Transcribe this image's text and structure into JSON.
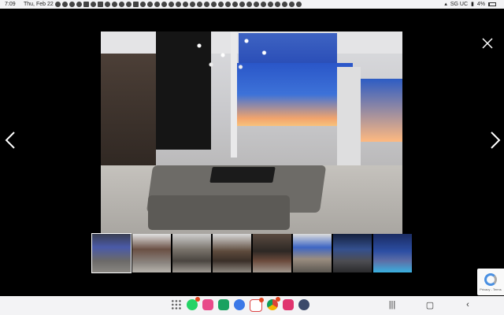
{
  "status_bar": {
    "time": "7:09",
    "date": "Thu, Feb 22",
    "carrier": "SG UC",
    "battery": "4%"
  },
  "viewer": {
    "main_image_alt": "",
    "prev_icon": "chevron-left-icon",
    "next_icon": "chevron-right-icon",
    "close_icon": "close-icon",
    "thumbnails_count": 8,
    "active_thumbnail": 1
  },
  "recaptcha": {
    "text": "Privacy - Terms"
  },
  "nav_bar": {
    "apps": [
      "apps-grid-icon",
      "whatsapp-icon",
      "messenger-icon",
      "chat-icon",
      "messages-icon",
      "gmail-icon",
      "chrome-icon",
      "flower-app-icon",
      "settings-icon"
    ],
    "recents_icon": "recents-icon",
    "home_icon": "home-icon",
    "back_icon": "back-icon"
  },
  "colors": {
    "background": "#000000",
    "status_bar": "#f3f3f5",
    "accent_blue": "#2a56c8"
  }
}
